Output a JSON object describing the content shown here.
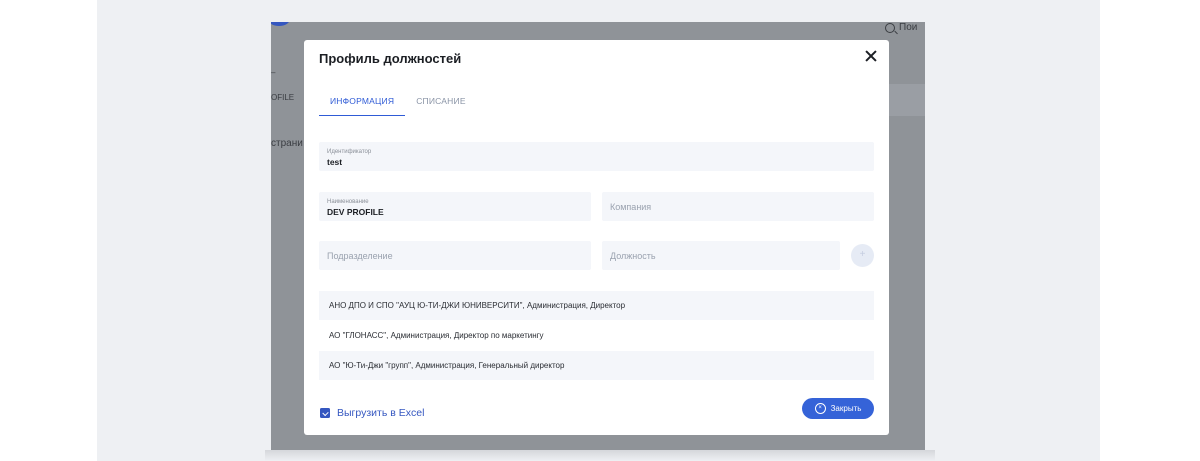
{
  "background": {
    "search_label": "Пои",
    "profile_fragment": "OFILE",
    "page_fragment": "страни",
    "dash_fragment": "–"
  },
  "modal": {
    "title": "Профиль должностей",
    "tabs": [
      {
        "label": "ИНФОРМАЦИЯ",
        "active": true
      },
      {
        "label": "СПИСАНИЕ",
        "active": false
      }
    ],
    "fields": {
      "identifier": {
        "label": "Идентификатор",
        "value": "test"
      },
      "name": {
        "label": "Наименование",
        "value": "DEV PROFILE"
      },
      "company": {
        "placeholder": "Компания"
      },
      "division": {
        "placeholder": "Подразделение"
      },
      "position": {
        "placeholder": "Должность"
      }
    },
    "add_button": "+",
    "rows": [
      "АНО ДПО И СПО \"АУЦ Ю-ТИ-ДЖИ ЮНИВЕРСИТИ\", Администрация, Директор",
      "АО \"ГЛОНАСС\", Администрация, Директор по маркетингу",
      "АО \"Ю-Ти-Джи \"групп\", Администрация, Генеральный директор"
    ],
    "export_label": "Выгрузить в Excel",
    "close_button_label": "Закрыть"
  },
  "colors": {
    "accent": "#3557c0",
    "overlay": "#8f9398",
    "field_bg": "#f4f6fa"
  }
}
